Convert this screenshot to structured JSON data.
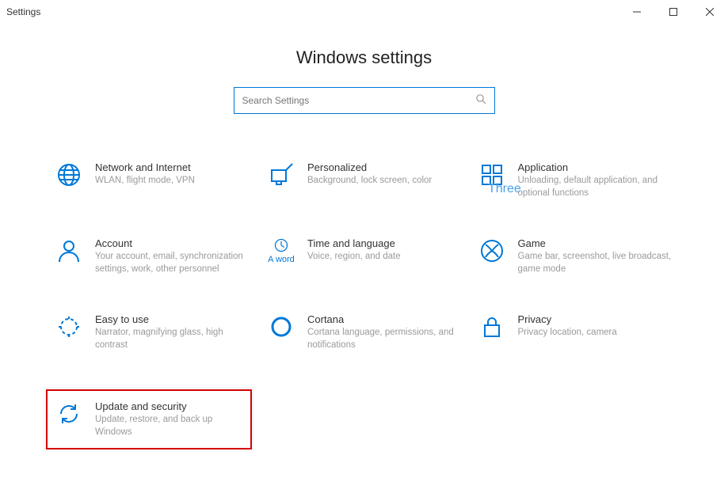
{
  "window": {
    "title": "Settings"
  },
  "page": {
    "heading": "Windows settings",
    "search_placeholder": "Search Settings"
  },
  "watermark": {
    "three": "Three"
  },
  "tiles": {
    "network": {
      "title": "Network and Internet",
      "sub": "WLAN, flight mode, VPN"
    },
    "personal": {
      "title": "Personalized",
      "sub": "Background, lock screen, color"
    },
    "apps": {
      "title": "Application",
      "sub": "Unloading, default application, and optional functions"
    },
    "account": {
      "title": "Account",
      "sub": "Your account, email, synchronization settings, work, other personnel"
    },
    "time": {
      "title": "Time and language",
      "sub": "Voice, region, and date",
      "badge": "A word"
    },
    "game": {
      "title": "Game",
      "sub": "Game bar, screenshot, live broadcast, game mode"
    },
    "ease": {
      "title": "Easy to use",
      "sub": "Narrator, magnifying glass, high contrast"
    },
    "cortana": {
      "title": "Cortana",
      "sub": "Cortana language, permissions, and notifications"
    },
    "privacy": {
      "title": "Privacy",
      "sub": "Privacy location, camera"
    },
    "update": {
      "title": "Update and security",
      "sub": "Update, restore, and back up Windows"
    }
  }
}
